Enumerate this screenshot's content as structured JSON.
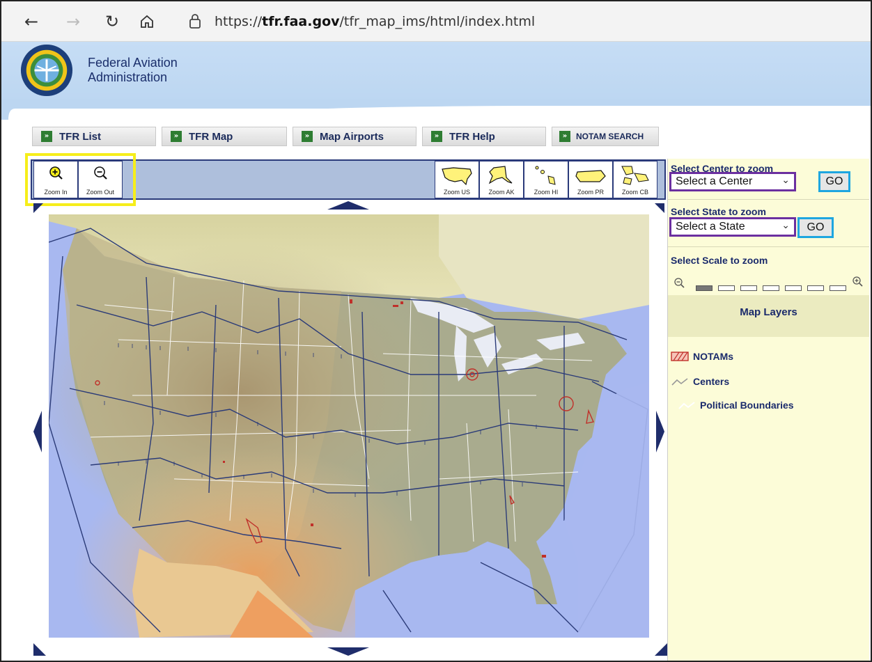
{
  "browser": {
    "url_host": "tfr.faa.gov",
    "url_path": "/tfr_map_ims/html/index.html",
    "url_scheme": "https://"
  },
  "header": {
    "org_line1": "Federal Aviation",
    "org_line2": "Administration",
    "brand_color": "#1a2e6b"
  },
  "nav_tabs": [
    {
      "label": "TFR List"
    },
    {
      "label": "TFR Map"
    },
    {
      "label": "Map Airports"
    },
    {
      "label": "TFR Help"
    },
    {
      "label": "NOTAM SEARCH"
    }
  ],
  "toolbar": {
    "zoom_in": "Zoom In",
    "zoom_out": "Zoom Out",
    "regions": [
      "Zoom US",
      "Zoom AK",
      "Zoom HI",
      "Zoom PR",
      "Zoom CB"
    ]
  },
  "panel": {
    "center_label": "Select Center to zoom",
    "center_value": "Select a Center",
    "state_label": "Select State to zoom",
    "state_value": "Select a State",
    "go_label": "GO",
    "scale_label": "Select Scale to zoom",
    "scale_level": 1,
    "scale_levels": 7,
    "layers_title": "Map Layers",
    "legend": [
      "NOTAMs",
      "Centers",
      "Political Boundaries"
    ]
  },
  "colors": {
    "highlight_yellow": "#f6ee1a",
    "select_border": "#6b2fa0",
    "go_border": "#1ea6e0",
    "notam_red": "#c0302a"
  }
}
